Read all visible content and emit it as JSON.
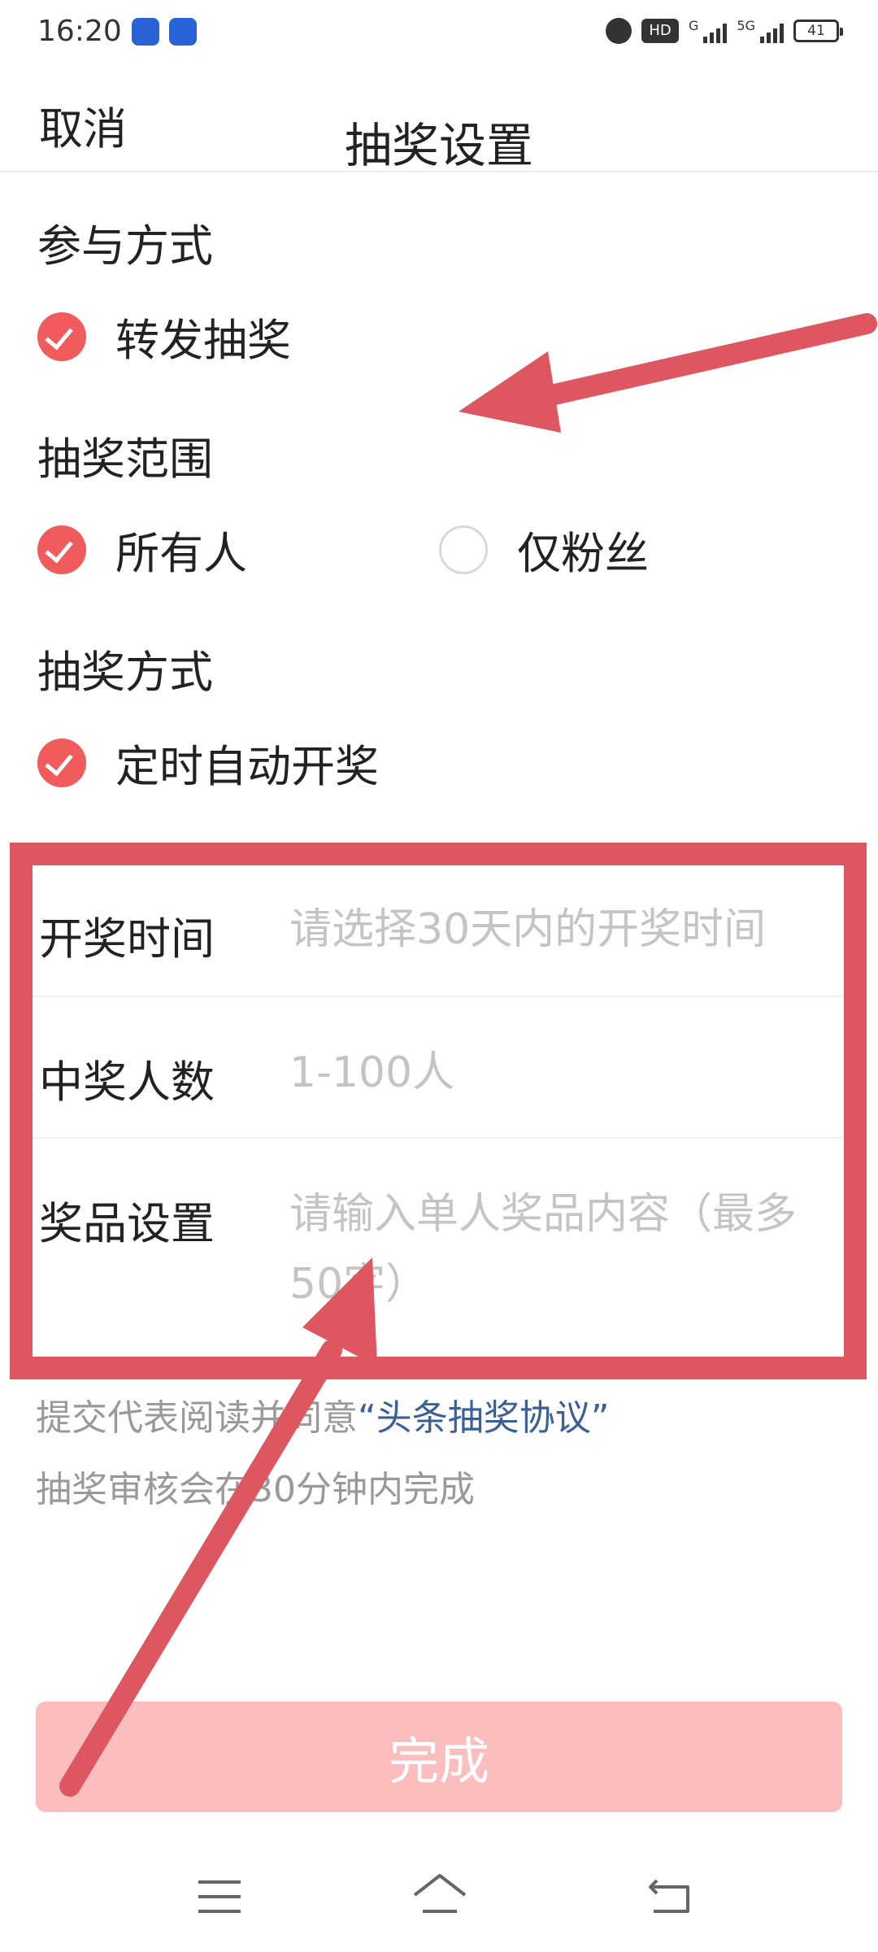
{
  "status_bar": {
    "time": "16:20",
    "hd_label": "HD",
    "network_g": "G",
    "network_5g": "5G",
    "battery": "41"
  },
  "header": {
    "cancel_label": "取消",
    "title": "抽奖设置"
  },
  "participation": {
    "title": "参与方式",
    "option": "转发抽奖"
  },
  "scope": {
    "title": "抽奖范围",
    "options": [
      "所有人",
      "仅粉丝"
    ],
    "selected": "所有人"
  },
  "method": {
    "title": "抽奖方式",
    "option": "定时自动开奖"
  },
  "form": {
    "draw_time_label": "开奖时间",
    "draw_time_placeholder": "请选择30天内的开奖时间",
    "winners_label": "中奖人数",
    "winners_placeholder": "1-100人",
    "prize_label": "奖品设置",
    "prize_placeholder": "请输入单人奖品内容（最多50字）"
  },
  "notes": {
    "agreement_prefix": "提交代表阅读并同意",
    "agreement_link": "“头条抽奖协议”",
    "review_note": "抽奖审核会在30分钟内完成"
  },
  "submit_label": "完成",
  "colors": {
    "accent": "#f25b5b",
    "annotation": "#dd5660",
    "submit_disabled": "#fbbdbd",
    "link": "#3a5f9b"
  }
}
